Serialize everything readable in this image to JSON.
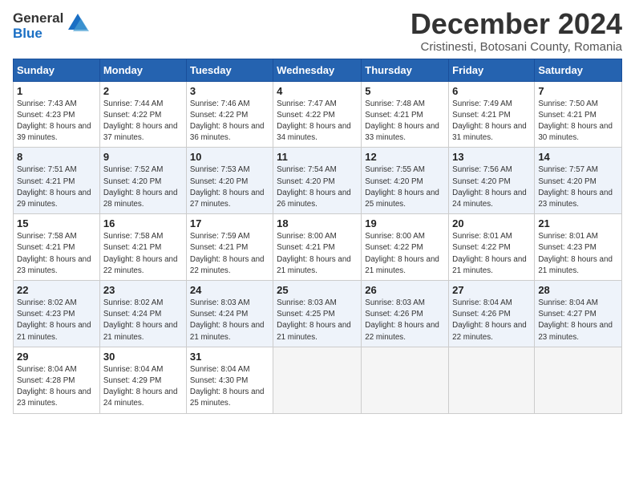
{
  "logo": {
    "general": "General",
    "blue": "Blue"
  },
  "title": {
    "month_year": "December 2024",
    "location": "Cristinesti, Botosani County, Romania"
  },
  "days_of_week": [
    "Sunday",
    "Monday",
    "Tuesday",
    "Wednesday",
    "Thursday",
    "Friday",
    "Saturday"
  ],
  "weeks": [
    [
      {
        "day": "1",
        "sunrise": "7:43 AM",
        "sunset": "4:23 PM",
        "daylight": "8 hours and 39 minutes."
      },
      {
        "day": "2",
        "sunrise": "7:44 AM",
        "sunset": "4:22 PM",
        "daylight": "8 hours and 37 minutes."
      },
      {
        "day": "3",
        "sunrise": "7:46 AM",
        "sunset": "4:22 PM",
        "daylight": "8 hours and 36 minutes."
      },
      {
        "day": "4",
        "sunrise": "7:47 AM",
        "sunset": "4:22 PM",
        "daylight": "8 hours and 34 minutes."
      },
      {
        "day": "5",
        "sunrise": "7:48 AM",
        "sunset": "4:21 PM",
        "daylight": "8 hours and 33 minutes."
      },
      {
        "day": "6",
        "sunrise": "7:49 AM",
        "sunset": "4:21 PM",
        "daylight": "8 hours and 31 minutes."
      },
      {
        "day": "7",
        "sunrise": "7:50 AM",
        "sunset": "4:21 PM",
        "daylight": "8 hours and 30 minutes."
      }
    ],
    [
      {
        "day": "8",
        "sunrise": "7:51 AM",
        "sunset": "4:21 PM",
        "daylight": "8 hours and 29 minutes."
      },
      {
        "day": "9",
        "sunrise": "7:52 AM",
        "sunset": "4:20 PM",
        "daylight": "8 hours and 28 minutes."
      },
      {
        "day": "10",
        "sunrise": "7:53 AM",
        "sunset": "4:20 PM",
        "daylight": "8 hours and 27 minutes."
      },
      {
        "day": "11",
        "sunrise": "7:54 AM",
        "sunset": "4:20 PM",
        "daylight": "8 hours and 26 minutes."
      },
      {
        "day": "12",
        "sunrise": "7:55 AM",
        "sunset": "4:20 PM",
        "daylight": "8 hours and 25 minutes."
      },
      {
        "day": "13",
        "sunrise": "7:56 AM",
        "sunset": "4:20 PM",
        "daylight": "8 hours and 24 minutes."
      },
      {
        "day": "14",
        "sunrise": "7:57 AM",
        "sunset": "4:20 PM",
        "daylight": "8 hours and 23 minutes."
      }
    ],
    [
      {
        "day": "15",
        "sunrise": "7:58 AM",
        "sunset": "4:21 PM",
        "daylight": "8 hours and 23 minutes."
      },
      {
        "day": "16",
        "sunrise": "7:58 AM",
        "sunset": "4:21 PM",
        "daylight": "8 hours and 22 minutes."
      },
      {
        "day": "17",
        "sunrise": "7:59 AM",
        "sunset": "4:21 PM",
        "daylight": "8 hours and 22 minutes."
      },
      {
        "day": "18",
        "sunrise": "8:00 AM",
        "sunset": "4:21 PM",
        "daylight": "8 hours and 21 minutes."
      },
      {
        "day": "19",
        "sunrise": "8:00 AM",
        "sunset": "4:22 PM",
        "daylight": "8 hours and 21 minutes."
      },
      {
        "day": "20",
        "sunrise": "8:01 AM",
        "sunset": "4:22 PM",
        "daylight": "8 hours and 21 minutes."
      },
      {
        "day": "21",
        "sunrise": "8:01 AM",
        "sunset": "4:23 PM",
        "daylight": "8 hours and 21 minutes."
      }
    ],
    [
      {
        "day": "22",
        "sunrise": "8:02 AM",
        "sunset": "4:23 PM",
        "daylight": "8 hours and 21 minutes."
      },
      {
        "day": "23",
        "sunrise": "8:02 AM",
        "sunset": "4:24 PM",
        "daylight": "8 hours and 21 minutes."
      },
      {
        "day": "24",
        "sunrise": "8:03 AM",
        "sunset": "4:24 PM",
        "daylight": "8 hours and 21 minutes."
      },
      {
        "day": "25",
        "sunrise": "8:03 AM",
        "sunset": "4:25 PM",
        "daylight": "8 hours and 21 minutes."
      },
      {
        "day": "26",
        "sunrise": "8:03 AM",
        "sunset": "4:26 PM",
        "daylight": "8 hours and 22 minutes."
      },
      {
        "day": "27",
        "sunrise": "8:04 AM",
        "sunset": "4:26 PM",
        "daylight": "8 hours and 22 minutes."
      },
      {
        "day": "28",
        "sunrise": "8:04 AM",
        "sunset": "4:27 PM",
        "daylight": "8 hours and 23 minutes."
      }
    ],
    [
      {
        "day": "29",
        "sunrise": "8:04 AM",
        "sunset": "4:28 PM",
        "daylight": "8 hours and 23 minutes."
      },
      {
        "day": "30",
        "sunrise": "8:04 AM",
        "sunset": "4:29 PM",
        "daylight": "8 hours and 24 minutes."
      },
      {
        "day": "31",
        "sunrise": "8:04 AM",
        "sunset": "4:30 PM",
        "daylight": "8 hours and 25 minutes."
      },
      null,
      null,
      null,
      null
    ]
  ]
}
